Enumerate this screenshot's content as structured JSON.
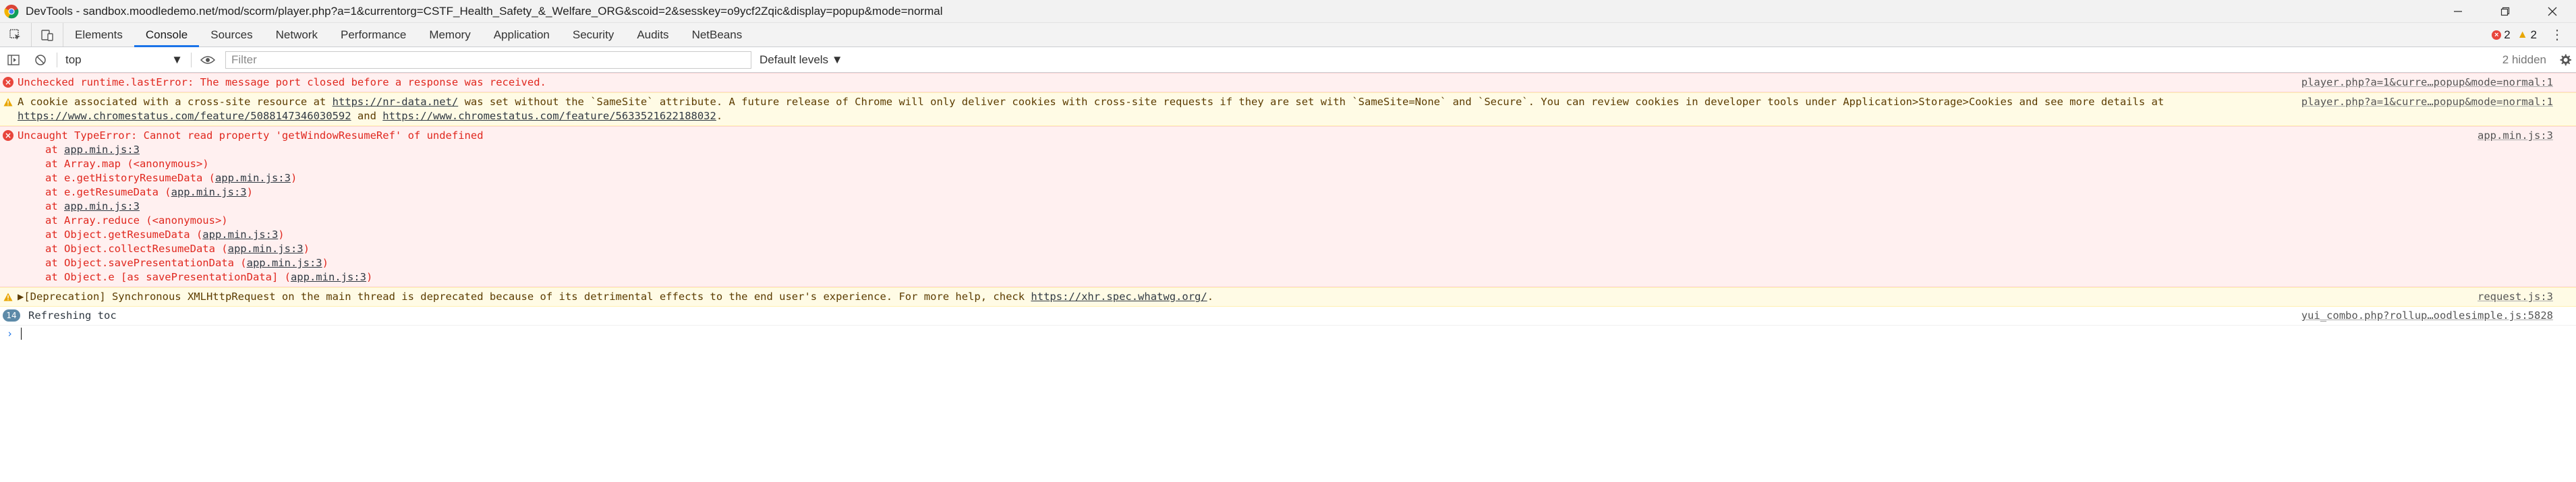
{
  "window": {
    "title": "DevTools - sandbox.moodledemo.net/mod/scorm/player.php?a=1&currentorg=CSTF_Health_Safety_&_Welfare_ORG&scoid=2&sesskey=o9ycf2Zqic&display=popup&mode=normal",
    "controls": [
      "minimize",
      "restore",
      "close"
    ]
  },
  "tabs": [
    "Elements",
    "Console",
    "Sources",
    "Network",
    "Performance",
    "Memory",
    "Application",
    "Security",
    "Audits",
    "NetBeans"
  ],
  "active_tab": "Console",
  "counters": {
    "errors": "2",
    "warnings": "2"
  },
  "toolbar": {
    "context": "top",
    "filter_placeholder": "Filter",
    "levels": "Default levels ▼",
    "hidden": "2 hidden"
  },
  "messages": [
    {
      "level": "error",
      "text": "Unchecked runtime.lastError: The message port closed before a response was received.",
      "source": "player.php?a=1&curre…popup&mode=normal:1"
    },
    {
      "level": "warning",
      "pre": "A cookie associated with a cross-site resource at ",
      "link1": "https://nr-data.net/",
      "mid": " was set without the `SameSite` attribute. A future release of Chrome will only deliver cookies with cross-site requests if they are set with `SameSite=None` and `Secure`. You can review cookies in developer tools under Application>Storage>Cookies and see more details at ",
      "link2": "https://www.chromestatus.com/feature/5088147346030592",
      "and": " and ",
      "link3": "https://www.chromestatus.com/feature/5633521622188032",
      "end": ".",
      "source": "player.php?a=1&curre…popup&mode=normal:1"
    },
    {
      "level": "error",
      "text": "Uncaught TypeError: Cannot read property 'getWindowResumeRef' of undefined",
      "source": "app.min.js:3",
      "stack": [
        {
          "pre": "at ",
          "fn": "",
          "link": "app.min.js:3",
          "post": ""
        },
        {
          "pre": "at Array.map (<anonymous>)",
          "fn": "",
          "link": "",
          "post": ""
        },
        {
          "pre": "at e.getHistoryResumeData (",
          "fn": "",
          "link": "app.min.js:3",
          "post": ")"
        },
        {
          "pre": "at e.getResumeData (",
          "fn": "",
          "link": "app.min.js:3",
          "post": ")"
        },
        {
          "pre": "at ",
          "fn": "",
          "link": "app.min.js:3",
          "post": ""
        },
        {
          "pre": "at Array.reduce (<anonymous>)",
          "fn": "",
          "link": "",
          "post": ""
        },
        {
          "pre": "at Object.getResumeData (",
          "fn": "",
          "link": "app.min.js:3",
          "post": ")"
        },
        {
          "pre": "at Object.collectResumeData (",
          "fn": "",
          "link": "app.min.js:3",
          "post": ")"
        },
        {
          "pre": "at Object.savePresentationData (",
          "fn": "",
          "link": "app.min.js:3",
          "post": ")"
        },
        {
          "pre": "at Object.e [as savePresentationData] (",
          "fn": "",
          "link": "app.min.js:3",
          "post": ")"
        }
      ]
    },
    {
      "level": "warning",
      "pre": "▶[Deprecation] Synchronous XMLHttpRequest on the main thread is deprecated because of its detrimental effects to the end user's experience. For more help, check ",
      "link1": "https://xhr.spec.whatwg.org/",
      "end": ".",
      "source": "request.js:3"
    },
    {
      "level": "info",
      "count": "14",
      "text": "Refreshing toc",
      "source": "yui_combo.php?rollup…oodlesimple.js:5828"
    }
  ],
  "colors": {
    "accent": "#1a73e8",
    "error": "#e8453c",
    "warning": "#e8a600"
  }
}
